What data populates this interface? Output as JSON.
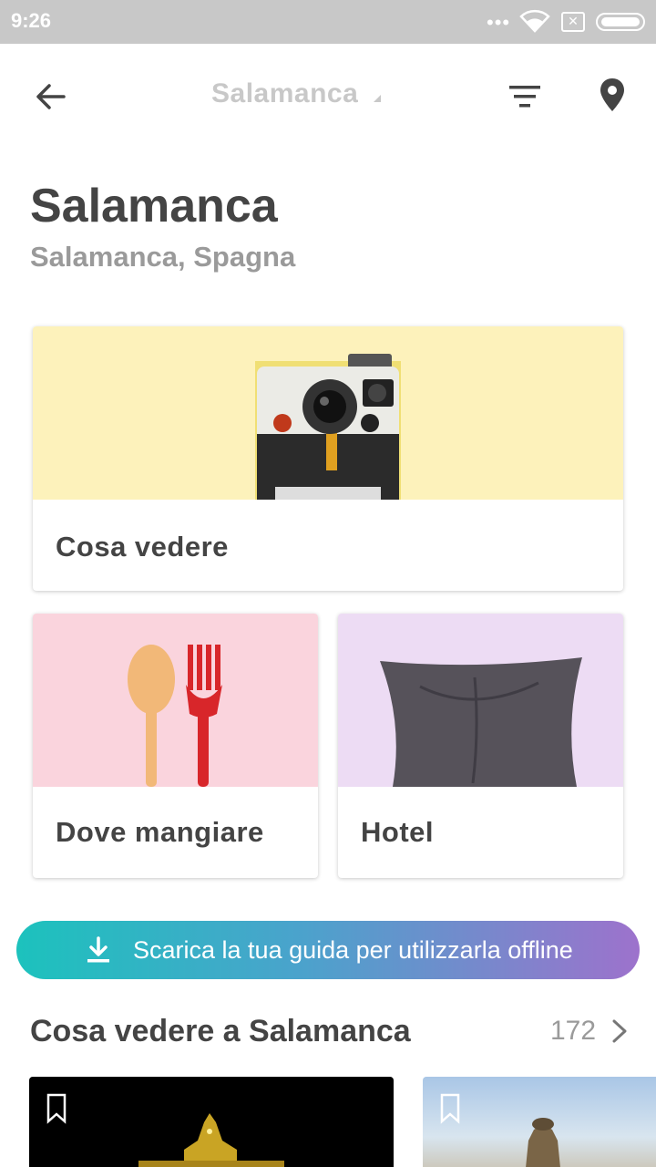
{
  "status_bar": {
    "time": "9:26",
    "signal_dots": "•••"
  },
  "app_bar": {
    "title": "Salamanca"
  },
  "header": {
    "city": "Salamanca",
    "subtitle": "Salamanca, Spagna"
  },
  "cards": {
    "see": {
      "label": "Cosa vedere"
    },
    "eat": {
      "label": "Dove mangiare"
    },
    "hotel": {
      "label": "Hotel"
    }
  },
  "download_banner": {
    "label": "Scarica la tua guida per utilizzarla offline"
  },
  "section": {
    "title": "Cosa vedere a Salamanca",
    "count": "172"
  },
  "colors": {
    "accent_start": "#1cc2bd",
    "accent_end": "#9d72cc",
    "card_see_bg": "#fdf2bb",
    "card_eat_bg": "#fad4dd",
    "card_hotel_bg": "#eddcf4"
  }
}
